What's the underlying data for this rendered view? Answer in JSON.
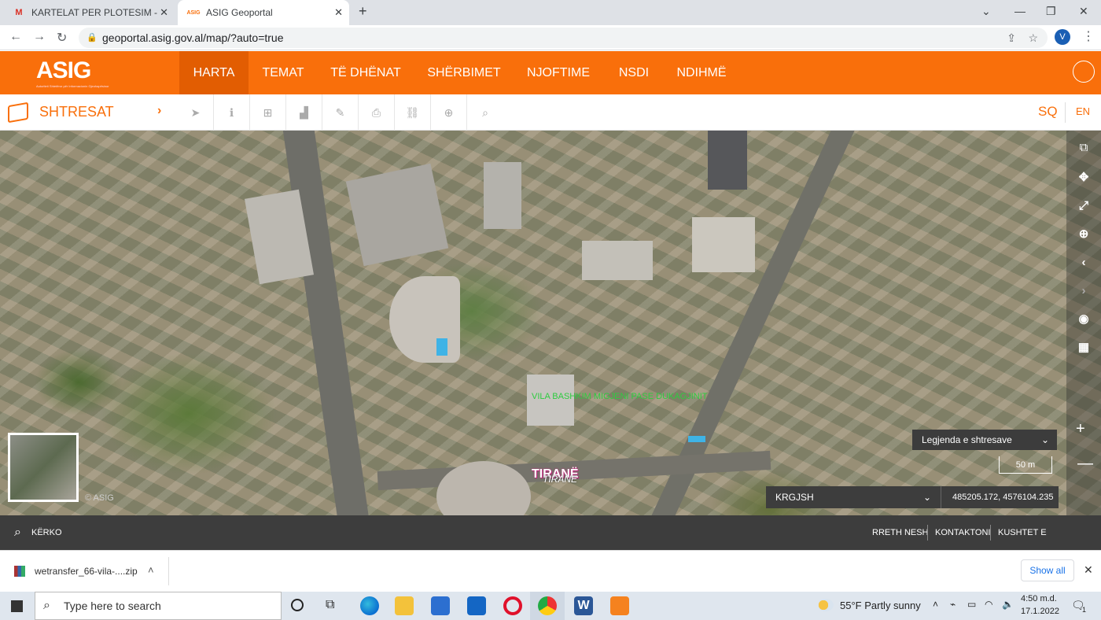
{
  "browser": {
    "tabs": [
      {
        "title": "KARTELAT PER PLOTESIM - vvorfi",
        "favicon": "gmail-icon"
      },
      {
        "title": "ASIG Geoportal",
        "favicon": "asig-icon"
      }
    ],
    "url": "geoportal.asig.gov.al/map/?auto=true",
    "profile_initial": "V"
  },
  "header": {
    "logo": "ASIG",
    "logo_sub": "Autoriteti Shtetëror për Informacionin Gjeohapësinor",
    "menu": [
      "HARTA",
      "TEMAT",
      "TË DHËNAT",
      "SHËRBIMET",
      "NJOFTIME",
      "NSDI",
      "NDIHMË"
    ]
  },
  "toolbar": {
    "layers_label": "SHTRESAT",
    "lang_sq": "SQ",
    "lang_en": "EN"
  },
  "map": {
    "feature_label": "VILA BASHKIM MIGJENI PASE DUKAGJINIT",
    "city_label": "TIRANË",
    "city_label_2": "TIRANE",
    "minimap_copyright": "© ASIG",
    "legend_label": "Legjenda e shtresave",
    "scale_label": "50 m",
    "crs_label": "KRGJSH",
    "coordinates": "485205.172, 4576104.235"
  },
  "footer": {
    "search_label": "KËRKO",
    "links": [
      "RRETH NESH",
      "KONTAKTONI",
      "KUSHTET E PËRDORIMIT"
    ]
  },
  "downloads": {
    "file_name": "wetransfer_66-vila-....zip",
    "show_all": "Show all"
  },
  "taskbar": {
    "search_placeholder": "Type here to search",
    "weather": "55°F  Partly sunny",
    "time": "4:50 m.d.",
    "date": "17.1.2022",
    "notification_count": "1"
  },
  "colors": {
    "brand": "#f96f0b",
    "brand_dark": "#e25d02",
    "map_label": "#2ecc40",
    "city_outline": "#c0227a"
  }
}
